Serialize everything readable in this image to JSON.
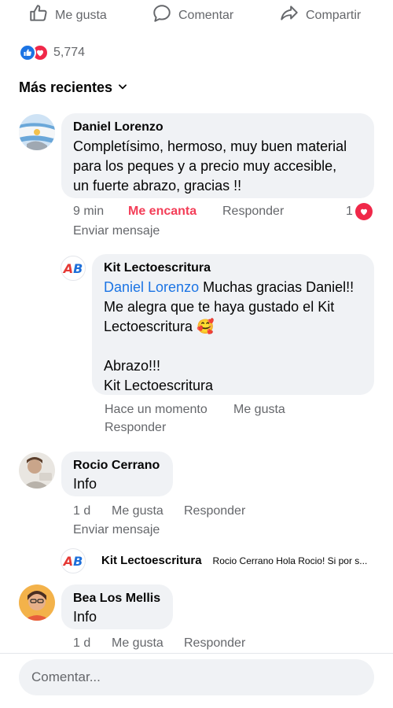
{
  "actions": {
    "like": "Me gusta",
    "comment": "Comentar",
    "share": "Compartir"
  },
  "reactions": {
    "count": "5,774"
  },
  "sort": {
    "label": "Más recientes"
  },
  "comments": [
    {
      "author": "Daniel Lorenzo",
      "text_lines": [
        "Completísimo, hermoso, muy buen material",
        "para los peques y a precio muy accesible,",
        "un fuerte abrazo, gracias !!"
      ],
      "time": "9 min",
      "reaction_label": "Me encanta",
      "reply": "Responder",
      "reaction_count": "1",
      "message": "Enviar mensaje",
      "replies": [
        {
          "author": "Kit Lectoescritura",
          "mention": "Daniel Lorenzo",
          "line1": " Muchas gracias Daniel!!",
          "line2": "Me alegra que te haya gustado el Kit",
          "line3": "Lectoescritura 🥰",
          "line4": "Abrazo!!!",
          "line5": "Kit Lectoescritura",
          "time": "Hace un momento",
          "like": "Me gusta",
          "reply": "Responder"
        }
      ]
    },
    {
      "author": "Rocio Cerrano",
      "text": "Info",
      "time": "1 d",
      "like": "Me gusta",
      "reply": "Responder",
      "message": "Enviar mensaje",
      "reply_preview": {
        "author": "Kit Lectoescritura",
        "text": "Rocio Cerrano Hola Rocio! Si por s..."
      }
    },
    {
      "author": "Bea Los Mellis",
      "text": "Info",
      "time": "1 d",
      "like": "Me gusta",
      "reply": "Responder"
    }
  ],
  "composer": {
    "placeholder": "Comentar..."
  },
  "logo": {
    "a": "A",
    "b": "B"
  },
  "colors": {
    "love": "#f33e58",
    "like_blue": "#1b74e4",
    "bubble": "#f0f2f5",
    "meta": "#65676b"
  }
}
